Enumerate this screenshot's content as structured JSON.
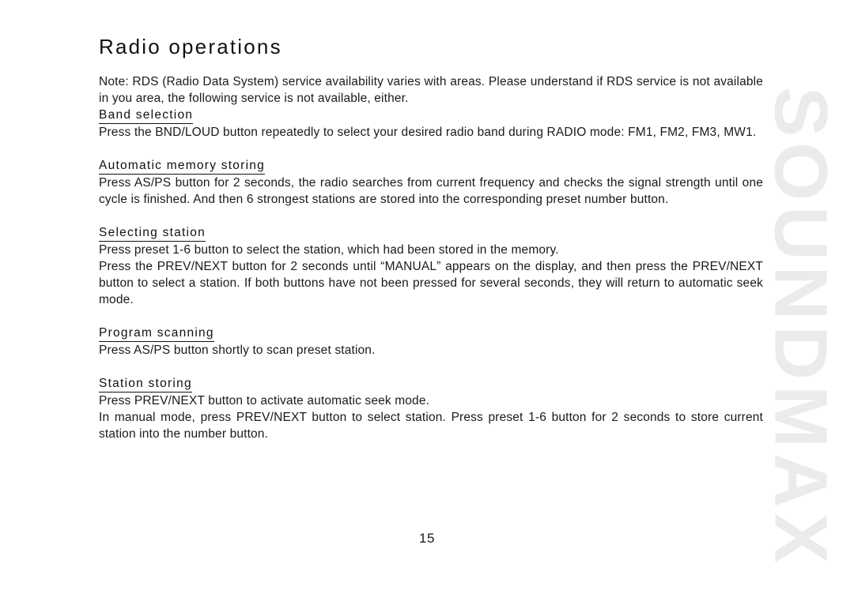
{
  "document": {
    "title": "Radio operations",
    "page_number": "15",
    "watermark": "SOUNDMAX",
    "watermark_color": "#ebebeb",
    "text_color": "#1a1a1a"
  },
  "intro": {
    "note": "Note: RDS (Radio Data System) service availability varies with areas. Please understand if RDS service is not available in you area, the following service is not available, either."
  },
  "sections": [
    {
      "heading": "Band selection",
      "paragraphs": [
        "Press the BND/LOUD button repeatedly to select your desired radio band during RADIO mode: FM1, FM2, FM3, MW1."
      ]
    },
    {
      "heading": "Automatic memory storing",
      "paragraphs": [
        "Press AS/PS button for 2 seconds, the radio searches from current frequency and checks the signal strength until one cycle is finished. And then 6 strongest stations are stored into the corresponding preset number button."
      ]
    },
    {
      "heading": "Selecting station",
      "paragraphs": [
        "Press preset 1-6 button to select the station, which had been stored in the memory.",
        "Press the PREV/NEXT button for 2 seconds until “MANUAL” appears on the display, and then press the PREV/NEXT button to select a station. If both buttons have not been pressed for several seconds, they will return to automatic seek mode."
      ]
    },
    {
      "heading": "Program scanning",
      "paragraphs": [
        "Press AS/PS button shortly to scan preset station."
      ]
    },
    {
      "heading": "Station storing",
      "paragraphs": [
        "Press PREV/NEXT button to activate automatic seek mode.",
        "In manual mode, press PREV/NEXT button to select station. Press preset 1-6 button for 2 seconds to store current station into the number button."
      ]
    }
  ]
}
